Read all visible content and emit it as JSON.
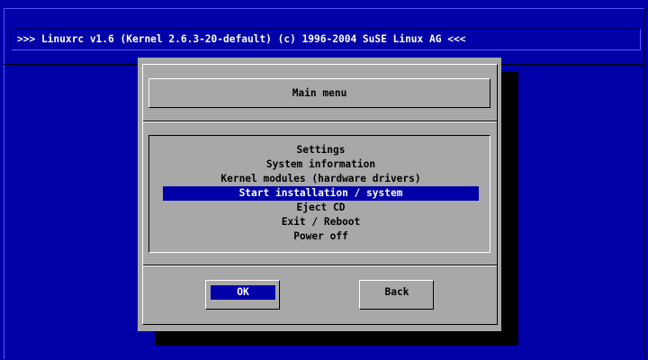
{
  "banner": {
    "text": ">>> Linuxrc v1.6 (Kernel 2.6.3-20-default) (c) 1996-2004 SuSE Linux AG <<<"
  },
  "dialog": {
    "title": "Main menu",
    "items": [
      {
        "label": "Settings",
        "selected": false
      },
      {
        "label": "System information",
        "selected": false
      },
      {
        "label": "Kernel modules (hardware drivers)",
        "selected": false
      },
      {
        "label": "Start installation / system",
        "selected": true
      },
      {
        "label": "Eject CD",
        "selected": false
      },
      {
        "label": "Exit / Reboot",
        "selected": false
      },
      {
        "label": "Power off",
        "selected": false
      }
    ],
    "ok_label": "OK",
    "back_label": "Back"
  },
  "colors": {
    "background": "#0000a8",
    "dialog": "#a8a8a8",
    "highlight": "#0000a8"
  }
}
